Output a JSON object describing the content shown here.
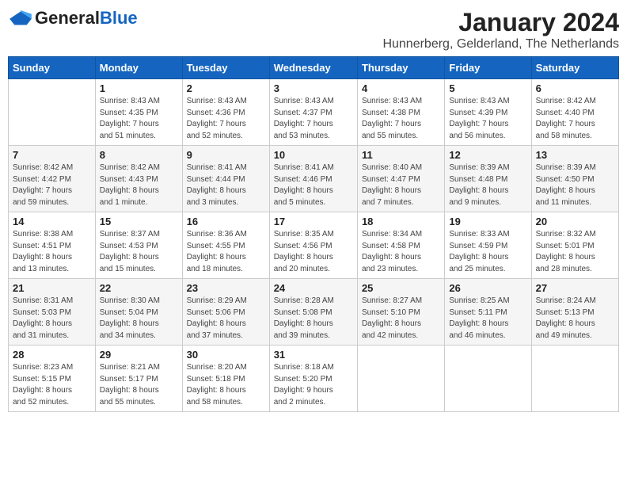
{
  "header": {
    "logo_general": "General",
    "logo_blue": "Blue",
    "month_title": "January 2024",
    "location": "Hunnerberg, Gelderland, The Netherlands"
  },
  "weekdays": [
    "Sunday",
    "Monday",
    "Tuesday",
    "Wednesday",
    "Thursday",
    "Friday",
    "Saturday"
  ],
  "weeks": [
    [
      {
        "day": "",
        "info": ""
      },
      {
        "day": "1",
        "info": "Sunrise: 8:43 AM\nSunset: 4:35 PM\nDaylight: 7 hours\nand 51 minutes."
      },
      {
        "day": "2",
        "info": "Sunrise: 8:43 AM\nSunset: 4:36 PM\nDaylight: 7 hours\nand 52 minutes."
      },
      {
        "day": "3",
        "info": "Sunrise: 8:43 AM\nSunset: 4:37 PM\nDaylight: 7 hours\nand 53 minutes."
      },
      {
        "day": "4",
        "info": "Sunrise: 8:43 AM\nSunset: 4:38 PM\nDaylight: 7 hours\nand 55 minutes."
      },
      {
        "day": "5",
        "info": "Sunrise: 8:43 AM\nSunset: 4:39 PM\nDaylight: 7 hours\nand 56 minutes."
      },
      {
        "day": "6",
        "info": "Sunrise: 8:42 AM\nSunset: 4:40 PM\nDaylight: 7 hours\nand 58 minutes."
      }
    ],
    [
      {
        "day": "7",
        "info": "Sunrise: 8:42 AM\nSunset: 4:42 PM\nDaylight: 7 hours\nand 59 minutes."
      },
      {
        "day": "8",
        "info": "Sunrise: 8:42 AM\nSunset: 4:43 PM\nDaylight: 8 hours\nand 1 minute."
      },
      {
        "day": "9",
        "info": "Sunrise: 8:41 AM\nSunset: 4:44 PM\nDaylight: 8 hours\nand 3 minutes."
      },
      {
        "day": "10",
        "info": "Sunrise: 8:41 AM\nSunset: 4:46 PM\nDaylight: 8 hours\nand 5 minutes."
      },
      {
        "day": "11",
        "info": "Sunrise: 8:40 AM\nSunset: 4:47 PM\nDaylight: 8 hours\nand 7 minutes."
      },
      {
        "day": "12",
        "info": "Sunrise: 8:39 AM\nSunset: 4:48 PM\nDaylight: 8 hours\nand 9 minutes."
      },
      {
        "day": "13",
        "info": "Sunrise: 8:39 AM\nSunset: 4:50 PM\nDaylight: 8 hours\nand 11 minutes."
      }
    ],
    [
      {
        "day": "14",
        "info": "Sunrise: 8:38 AM\nSunset: 4:51 PM\nDaylight: 8 hours\nand 13 minutes."
      },
      {
        "day": "15",
        "info": "Sunrise: 8:37 AM\nSunset: 4:53 PM\nDaylight: 8 hours\nand 15 minutes."
      },
      {
        "day": "16",
        "info": "Sunrise: 8:36 AM\nSunset: 4:55 PM\nDaylight: 8 hours\nand 18 minutes."
      },
      {
        "day": "17",
        "info": "Sunrise: 8:35 AM\nSunset: 4:56 PM\nDaylight: 8 hours\nand 20 minutes."
      },
      {
        "day": "18",
        "info": "Sunrise: 8:34 AM\nSunset: 4:58 PM\nDaylight: 8 hours\nand 23 minutes."
      },
      {
        "day": "19",
        "info": "Sunrise: 8:33 AM\nSunset: 4:59 PM\nDaylight: 8 hours\nand 25 minutes."
      },
      {
        "day": "20",
        "info": "Sunrise: 8:32 AM\nSunset: 5:01 PM\nDaylight: 8 hours\nand 28 minutes."
      }
    ],
    [
      {
        "day": "21",
        "info": "Sunrise: 8:31 AM\nSunset: 5:03 PM\nDaylight: 8 hours\nand 31 minutes."
      },
      {
        "day": "22",
        "info": "Sunrise: 8:30 AM\nSunset: 5:04 PM\nDaylight: 8 hours\nand 34 minutes."
      },
      {
        "day": "23",
        "info": "Sunrise: 8:29 AM\nSunset: 5:06 PM\nDaylight: 8 hours\nand 37 minutes."
      },
      {
        "day": "24",
        "info": "Sunrise: 8:28 AM\nSunset: 5:08 PM\nDaylight: 8 hours\nand 39 minutes."
      },
      {
        "day": "25",
        "info": "Sunrise: 8:27 AM\nSunset: 5:10 PM\nDaylight: 8 hours\nand 42 minutes."
      },
      {
        "day": "26",
        "info": "Sunrise: 8:25 AM\nSunset: 5:11 PM\nDaylight: 8 hours\nand 46 minutes."
      },
      {
        "day": "27",
        "info": "Sunrise: 8:24 AM\nSunset: 5:13 PM\nDaylight: 8 hours\nand 49 minutes."
      }
    ],
    [
      {
        "day": "28",
        "info": "Sunrise: 8:23 AM\nSunset: 5:15 PM\nDaylight: 8 hours\nand 52 minutes."
      },
      {
        "day": "29",
        "info": "Sunrise: 8:21 AM\nSunset: 5:17 PM\nDaylight: 8 hours\nand 55 minutes."
      },
      {
        "day": "30",
        "info": "Sunrise: 8:20 AM\nSunset: 5:18 PM\nDaylight: 8 hours\nand 58 minutes."
      },
      {
        "day": "31",
        "info": "Sunrise: 8:18 AM\nSunset: 5:20 PM\nDaylight: 9 hours\nand 2 minutes."
      },
      {
        "day": "",
        "info": ""
      },
      {
        "day": "",
        "info": ""
      },
      {
        "day": "",
        "info": ""
      }
    ]
  ]
}
